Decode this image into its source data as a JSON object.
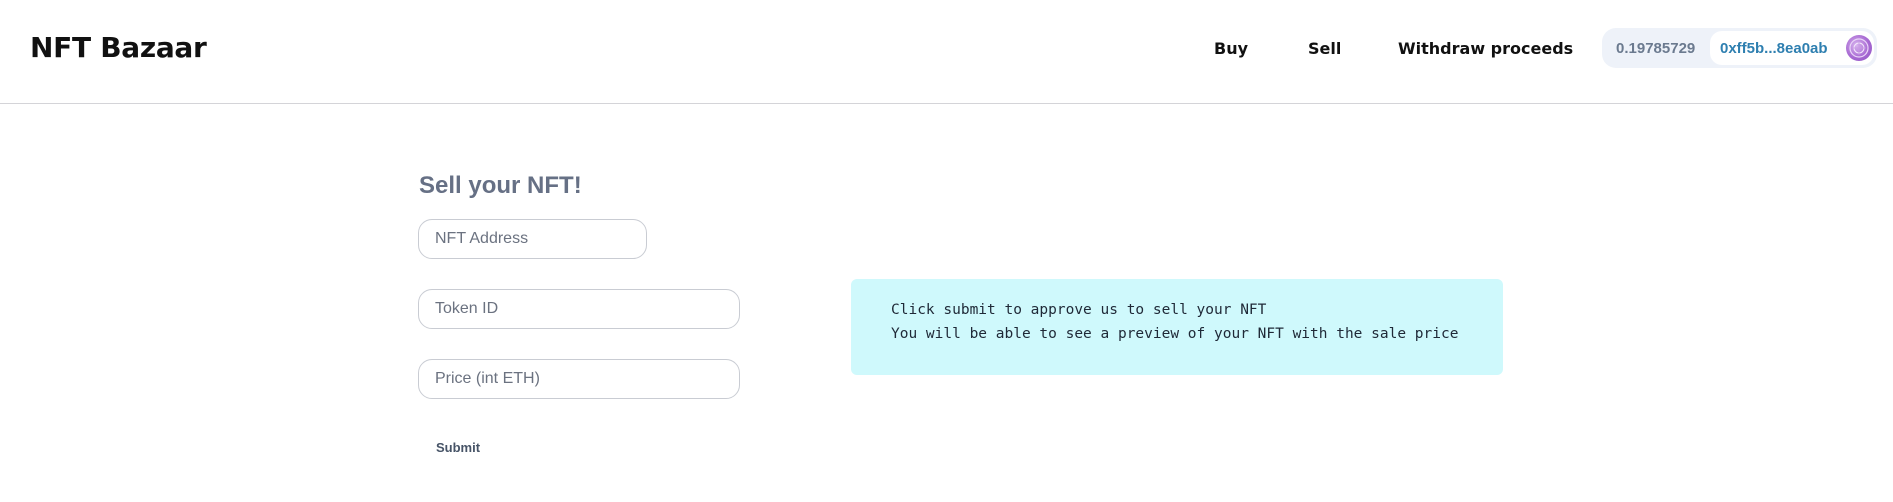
{
  "header": {
    "brand": "NFT Bazaar",
    "nav": {
      "buy": "Buy",
      "sell": "Sell",
      "withdraw": "Withdraw proceeds"
    },
    "account": {
      "balance": "0.19785729",
      "address": "0xff5b...8ea0ab",
      "avatar_icon": "account-avatar-icon"
    }
  },
  "form": {
    "title": "Sell your NFT!",
    "nft_address_placeholder": "NFT Address",
    "token_id_placeholder": "Token ID",
    "price_placeholder": "Price (int ETH)",
    "submit_label": "Submit"
  },
  "info": {
    "line1": "Click submit to approve us to sell your NFT",
    "line2": "You will be able to see a preview of your NFT with the sale price"
  },
  "colors": {
    "info_background": "#cff9fc",
    "address_text": "#2e7fb0",
    "title_text": "#667085"
  }
}
